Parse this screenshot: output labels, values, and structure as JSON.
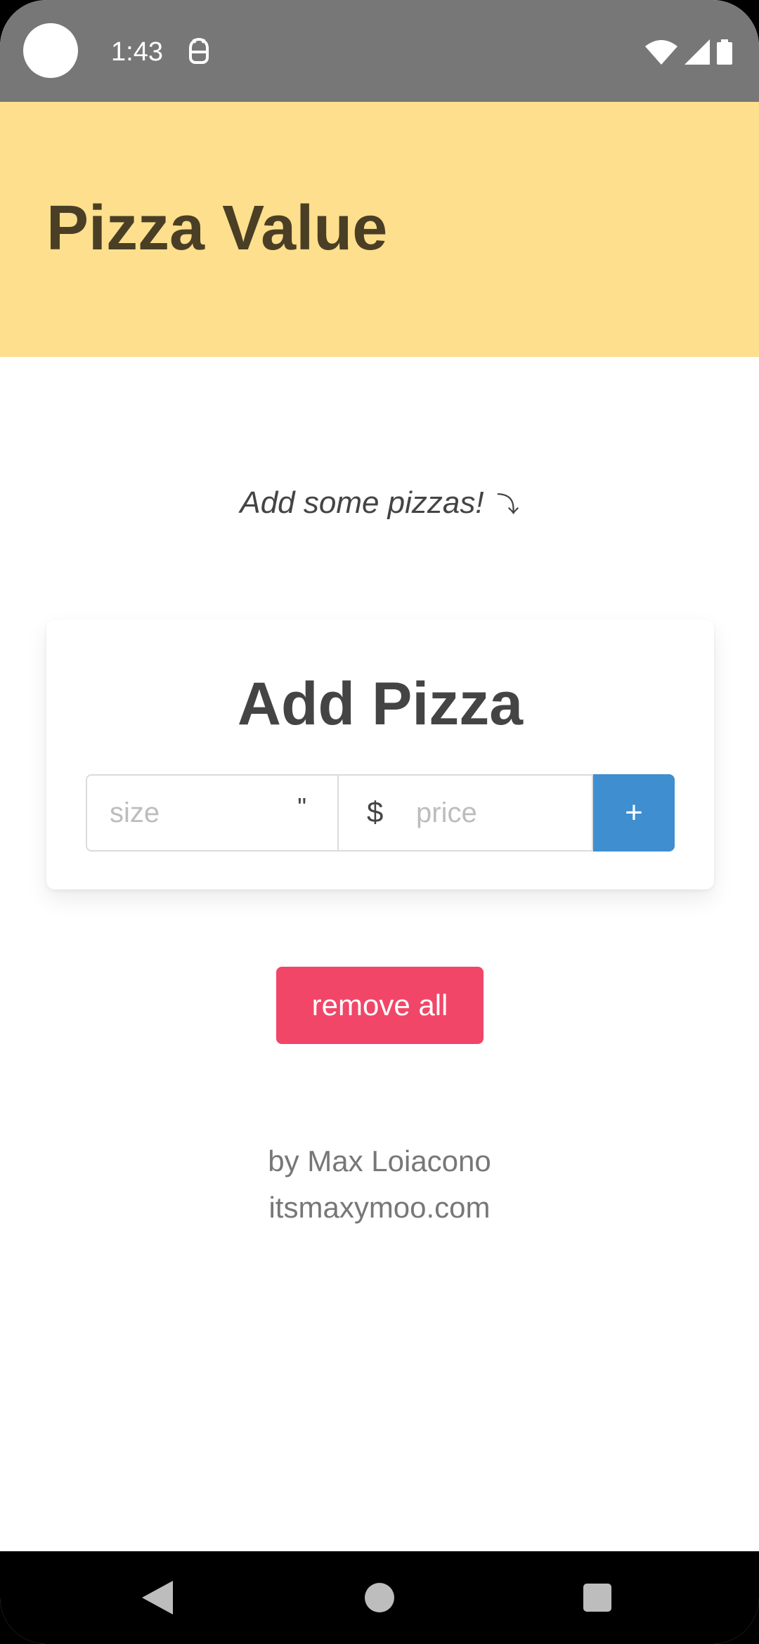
{
  "status_bar": {
    "time": "1:43",
    "notification_icon": "android-debug-icon",
    "wifi_icon": "wifi-icon",
    "signal_icon": "cell-signal-icon",
    "battery_icon": "battery-icon"
  },
  "header": {
    "title": "Pizza Value",
    "background_color": "#fddf8e",
    "text_color": "#4a3f25"
  },
  "main": {
    "prompt": "Add some pizzas!",
    "prompt_arrow": "⤵"
  },
  "add_pizza": {
    "title": "Add Pizza",
    "size_placeholder": "size",
    "size_value": "",
    "size_unit": "\"",
    "currency_symbol": "$",
    "price_placeholder": "price",
    "price_value": "",
    "add_label": "+",
    "add_color": "#3e8ed0"
  },
  "remove_all": {
    "label": "remove all",
    "color": "#f14668"
  },
  "footer": {
    "author": "by Max Loiacono",
    "website": "itsmaxymoo.com"
  },
  "nav_bar": {
    "back_icon": "back-triangle-icon",
    "home_icon": "home-circle-icon",
    "recents_icon": "recents-square-icon"
  }
}
